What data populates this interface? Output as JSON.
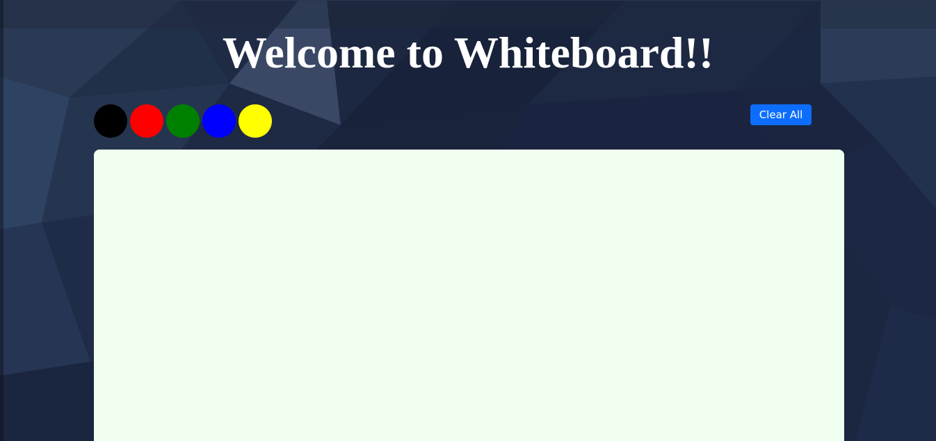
{
  "header": {
    "title": "Welcome to Whiteboard!!"
  },
  "toolbar": {
    "colors": [
      {
        "name": "black",
        "hex": "#000000"
      },
      {
        "name": "red",
        "hex": "#ff0000"
      },
      {
        "name": "green",
        "hex": "#008000"
      },
      {
        "name": "blue",
        "hex": "#0000ff"
      },
      {
        "name": "yellow",
        "hex": "#ffff00"
      }
    ],
    "clear_label": "Clear All"
  },
  "theme": {
    "background": "#1b2640",
    "button": "#0d6efd",
    "canvas": "#f1fff1"
  }
}
